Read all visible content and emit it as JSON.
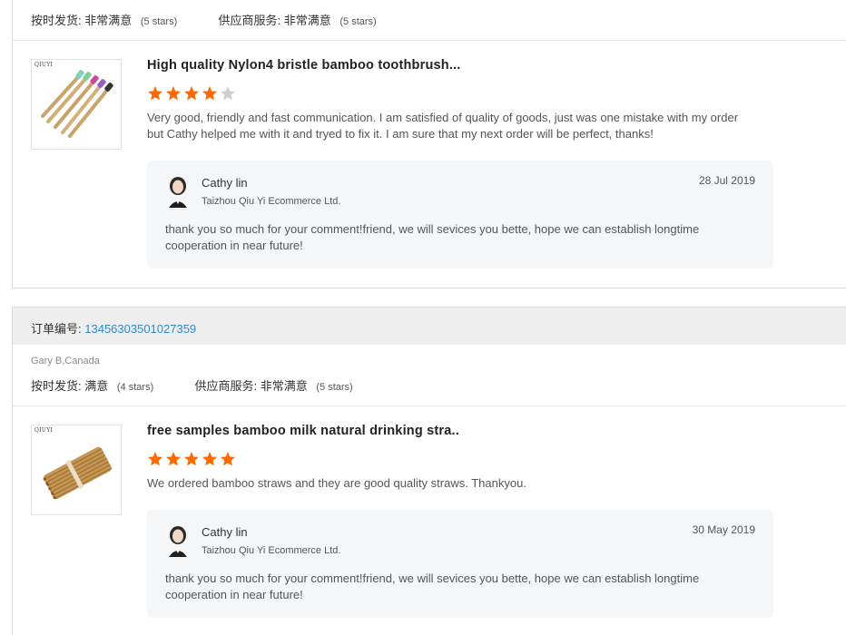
{
  "colors": {
    "star_on": "#ff6a00",
    "star_off": "#cfcfcf",
    "link": "#2e8bc9"
  },
  "reviews": [
    {
      "ratings": {
        "delivery_label": "按时发货:",
        "delivery_value": "非常满意",
        "delivery_stars": "(5 stars)",
        "service_label": "供应商服务:",
        "service_value": "非常满意",
        "service_stars": "(5 stars)"
      },
      "product_title": "High quality Nylon4 bristle bamboo toothbrush...",
      "product_image_logo": "QIUYI",
      "stars": 4,
      "review_text": "Very good, friendly and fast communication. I am satisfied of quality of goods, just was one mistake with my order but Cathy helped me with it and tryed to fix it. I am sure that my next order will be perfect, thanks!",
      "reply": {
        "name": "Cathy lin",
        "company": "Taizhou Qiu Yi Ecommerce Ltd.",
        "date": "28 Jul 2019",
        "text": "thank you so much for your comment!friend, we will sevices you bette, hope we can establish longtime cooperation in near future!"
      }
    },
    {
      "order_label": "订单编号:",
      "order_number": "13456303501027359",
      "buyer": "Gary B,Canada",
      "ratings": {
        "delivery_label": "按时发货:",
        "delivery_value": "满意",
        "delivery_stars": "(4 stars)",
        "service_label": "供应商服务:",
        "service_value": "非常满意",
        "service_stars": "(5 stars)"
      },
      "product_title": "free samples bamboo milk natural drinking stra..",
      "product_image_logo": "QIUYI",
      "stars": 5,
      "review_text": "We ordered bamboo straws and they are good quality straws. Thankyou.",
      "reply": {
        "name": "Cathy lin",
        "company": "Taizhou Qiu Yi Ecommerce Ltd.",
        "date": "30 May 2019",
        "text": "thank you so much for your comment!friend, we will sevices you bette, hope we can establish longtime cooperation in near future!"
      }
    }
  ]
}
